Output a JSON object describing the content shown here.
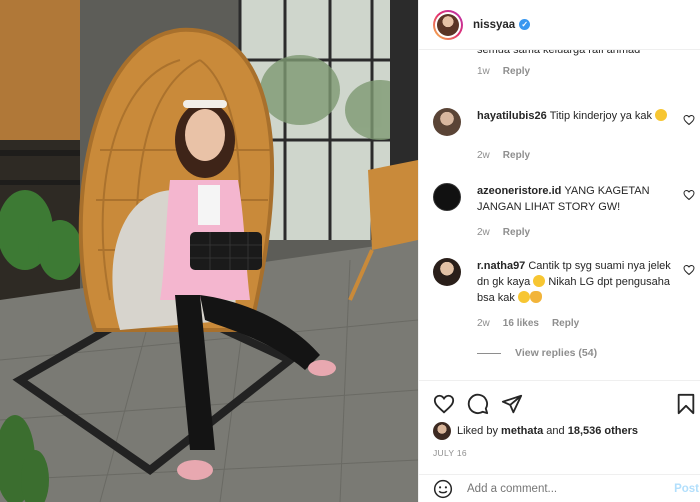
{
  "post": {
    "username": "nissyaa",
    "verified": true
  },
  "comments": [
    {
      "partial_text": "semua sama keluarga rafi ahmad",
      "time": "1w",
      "reply_label": "Reply"
    },
    {
      "username": "hayatilubis26",
      "text": "Titip kinderjoy ya kak",
      "time": "2w",
      "reply_label": "Reply"
    },
    {
      "username": "azeoneristore.id",
      "text": "YANG KAGETAN JANGAN LIHAT STORY GW!",
      "time": "2w",
      "reply_label": "Reply"
    },
    {
      "username": "r.natha97",
      "text_part1": "Cantik tp syg suami nya jelek dn gk kaya",
      "text_part2": " Nikah LG dpt pengusaha bsa kak",
      "time": "2w",
      "likes": "16 likes",
      "reply_label": "Reply",
      "view_replies": "View replies (54)"
    }
  ],
  "likes": {
    "prefix": "Liked by",
    "liker": "methata",
    "joiner": "and",
    "others": "18,536 others"
  },
  "date": "JULY 16",
  "add_comment": {
    "placeholder": "Add a comment...",
    "post_label": "Post"
  },
  "icons": {
    "like": "heart-icon",
    "comment": "comment-icon",
    "share": "paper-plane-icon",
    "save": "bookmark-icon",
    "emoji": "smiley-icon",
    "verified": "verified-badge-icon"
  },
  "colors": {
    "text": "#262626",
    "muted": "#8e8e8e",
    "verified": "#3897f0",
    "post_button": "#b2dffc",
    "divider": "#efefef"
  }
}
